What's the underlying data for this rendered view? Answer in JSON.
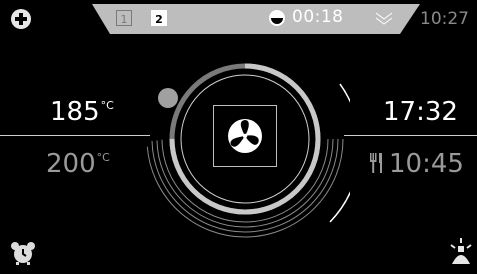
{
  "topbar": {
    "programs": [
      "1",
      "2"
    ],
    "active_program": "2",
    "timer": "00:18",
    "clock": "10:27"
  },
  "oven": {
    "current_temp": "185",
    "target_temp": "200",
    "temp_unit": "°C",
    "end_time": "17:32",
    "cook_time": "10:45",
    "heating_progress": 0.75,
    "mode": "fan-icon"
  },
  "icons": {
    "add": "plus-circle-icon",
    "timer": "pie-clock-icon",
    "collapse": "chevron-double-down-icon",
    "alarm": "alarm-clock-icon",
    "light": "lamp-icon",
    "cutlery": "fork-knife-icon"
  },
  "colors": {
    "background": "#000000",
    "ring": "#9a9a9a",
    "text_primary": "#ffffff",
    "text_secondary": "#9a9a9a",
    "topbar": "#bdbdbd"
  }
}
